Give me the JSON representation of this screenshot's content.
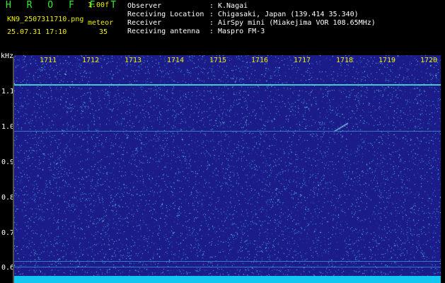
{
  "header": {
    "brand": "H R O F F T",
    "version": "1.00f",
    "filename": "KN9_2507311710.png",
    "timestamp": "25.07.31 17:10",
    "meteor_label": "meteor",
    "meteor_count": "35"
  },
  "info": [
    {
      "label": "Observer",
      "value": "K.Nagai"
    },
    {
      "label": "Receiving Location",
      "value": "Chigasaki, Japan (139.414 35.340)"
    },
    {
      "label": "Receiver",
      "value": "AirSpy mini (Miakejima VOR 108.65MHz)"
    },
    {
      "label": "Receiving antenna",
      "value": "Maspro FM-3"
    }
  ],
  "separator": ":",
  "y_axis": {
    "unit": "kHz",
    "ticks": [
      "1.1",
      "1.0",
      "0.9",
      "0.8",
      "0.7",
      "0.6"
    ]
  },
  "x_axis": {
    "ticks": [
      "1711",
      "1712",
      "1713",
      "1714",
      "1715",
      "1716",
      "1717",
      "1718",
      "1719",
      "1720"
    ]
  },
  "colors": {
    "background": "#1b1c8a",
    "noise": "#3a8fd8",
    "carrier": "#46c8d0",
    "label_yellow": "#f0f000",
    "brand_green": "#30f030"
  }
}
